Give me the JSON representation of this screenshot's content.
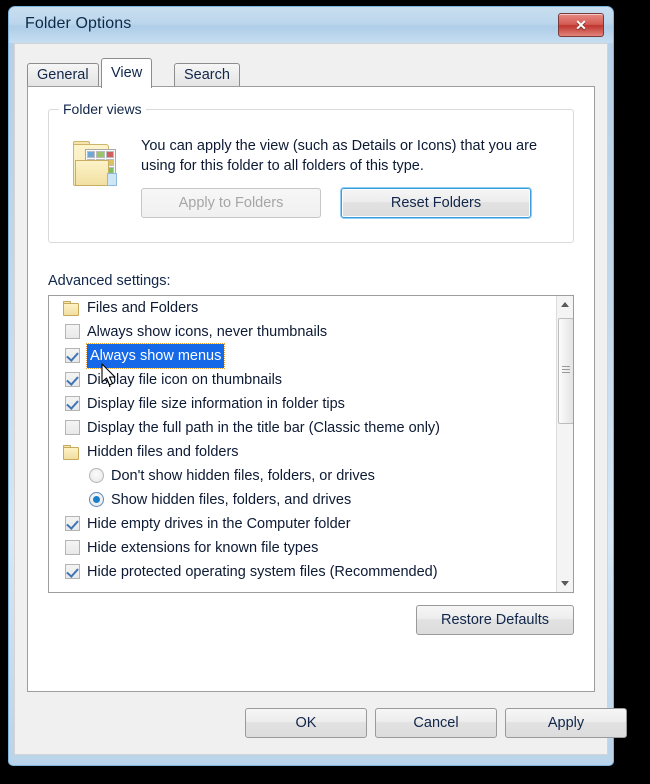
{
  "window": {
    "title": "Folder Options",
    "close_icon": "close-x-icon",
    "frame_color": "#b4cfe7"
  },
  "tabs": [
    {
      "label": "General",
      "active": false
    },
    {
      "label": "View",
      "active": true
    },
    {
      "label": "Search",
      "active": false
    }
  ],
  "folder_views": {
    "group_title": "Folder views",
    "icon": "folder-thumbnails-icon",
    "description": "You can apply the view (such as Details or Icons) that you are using for this folder to all folders of this type.",
    "apply_button": {
      "label": "Apply to Folders",
      "enabled": false
    },
    "reset_button": {
      "label": "Reset Folders",
      "enabled": true,
      "focused": true
    }
  },
  "advanced": {
    "label": "Advanced settings:",
    "selection_color": "#1569e8",
    "items": [
      {
        "type": "group",
        "label": "Files and Folders",
        "icon": "folder-icon"
      },
      {
        "type": "checkbox",
        "label": "Always show icons, never thumbnails",
        "checked": false
      },
      {
        "type": "checkbox",
        "label": "Always show menus",
        "checked": true,
        "selected": true
      },
      {
        "type": "checkbox",
        "label": "Display file icon on thumbnails",
        "checked": true
      },
      {
        "type": "checkbox",
        "label": "Display file size information in folder tips",
        "checked": true
      },
      {
        "type": "checkbox",
        "label": "Display the full path in the title bar (Classic theme only)",
        "checked": false
      },
      {
        "type": "group",
        "label": "Hidden files and folders",
        "icon": "folder-icon"
      },
      {
        "type": "radio",
        "label": "Don't show hidden files, folders, or drives",
        "selected_radio": false
      },
      {
        "type": "radio",
        "label": "Show hidden files, folders, and drives",
        "selected_radio": true
      },
      {
        "type": "checkbox",
        "label": "Hide empty drives in the Computer folder",
        "checked": true
      },
      {
        "type": "checkbox",
        "label": "Hide extensions for known file types",
        "checked": false
      },
      {
        "type": "checkbox",
        "label": "Hide protected operating system files (Recommended)",
        "checked": true
      }
    ],
    "scrollbar": {
      "up_icon": "scroll-up-arrow-icon",
      "down_icon": "scroll-down-arrow-icon",
      "thumb_icon": "scrollbar-thumb"
    },
    "restore_defaults": "Restore Defaults"
  },
  "footer": {
    "ok": "OK",
    "cancel": "Cancel",
    "apply": "Apply"
  },
  "cursor": {
    "icon": "mouse-pointer-icon"
  }
}
